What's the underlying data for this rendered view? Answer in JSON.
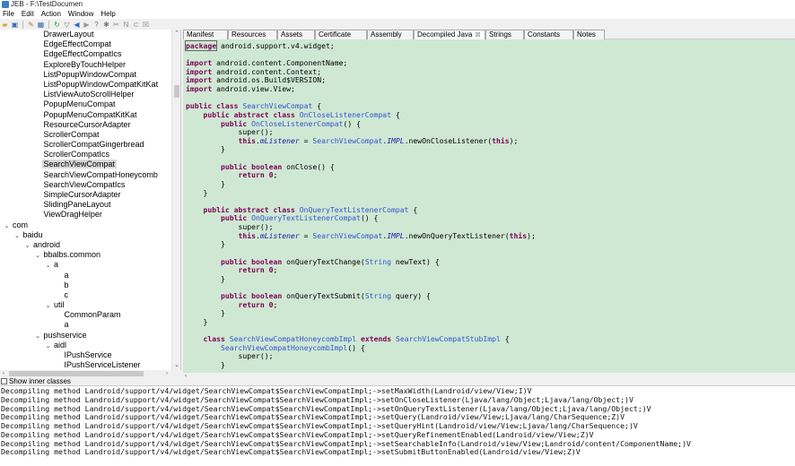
{
  "window": {
    "title": "JEB - F:\\TestDocumen"
  },
  "menu": [
    "File",
    "Edit",
    "Action",
    "Window",
    "Help"
  ],
  "toolbar_icons": [
    "open-icon",
    "save-icon",
    "wrench-icon",
    "grid-icon",
    "refresh-icon",
    "bookmark-icon",
    "back-icon",
    "forward-icon",
    "help-icon",
    "settings-icon",
    "cut-icon",
    "rename-icon",
    "link-icon",
    "comment-icon"
  ],
  "tree": {
    "rows": [
      {
        "label": "DrawerLayout",
        "indent": 3,
        "toggle": ""
      },
      {
        "label": "EdgeEffectCompat",
        "indent": 3,
        "toggle": ""
      },
      {
        "label": "EdgeEffectCompatIcs",
        "indent": 3,
        "toggle": ""
      },
      {
        "label": "ExploreByTouchHelper",
        "indent": 3,
        "toggle": ""
      },
      {
        "label": "ListPopupWindowCompat",
        "indent": 3,
        "toggle": ""
      },
      {
        "label": "ListPopupWindowCompatKitKat",
        "indent": 3,
        "toggle": ""
      },
      {
        "label": "ListViewAutoScrollHelper",
        "indent": 3,
        "toggle": ""
      },
      {
        "label": "PopupMenuCompat",
        "indent": 3,
        "toggle": ""
      },
      {
        "label": "PopupMenuCompatKitKat",
        "indent": 3,
        "toggle": ""
      },
      {
        "label": "ResourceCursorAdapter",
        "indent": 3,
        "toggle": ""
      },
      {
        "label": "ScrollerCompat",
        "indent": 3,
        "toggle": ""
      },
      {
        "label": "ScrollerCompatGingerbread",
        "indent": 3,
        "toggle": ""
      },
      {
        "label": "ScrollerCompatIcs",
        "indent": 3,
        "toggle": ""
      },
      {
        "label": "SearchViewCompat",
        "indent": 3,
        "toggle": "",
        "selected": true
      },
      {
        "label": "SearchViewCompatHoneycomb",
        "indent": 3,
        "toggle": ""
      },
      {
        "label": "SearchViewCompatIcs",
        "indent": 3,
        "toggle": ""
      },
      {
        "label": "SimpleCursorAdapter",
        "indent": 3,
        "toggle": ""
      },
      {
        "label": "SlidingPaneLayout",
        "indent": 3,
        "toggle": ""
      },
      {
        "label": "ViewDragHelper",
        "indent": 3,
        "toggle": ""
      },
      {
        "label": "com",
        "indent": 0,
        "toggle": "v"
      },
      {
        "label": "baidu",
        "indent": 1,
        "toggle": "v"
      },
      {
        "label": "android",
        "indent": 2,
        "toggle": "v"
      },
      {
        "label": "bbalbs.common",
        "indent": 3,
        "toggle": "v"
      },
      {
        "label": "a",
        "indent": 4,
        "toggle": "v"
      },
      {
        "label": "a",
        "indent": 5,
        "toggle": ""
      },
      {
        "label": "b",
        "indent": 5,
        "toggle": ""
      },
      {
        "label": "c",
        "indent": 5,
        "toggle": ""
      },
      {
        "label": "util",
        "indent": 4,
        "toggle": "v"
      },
      {
        "label": "CommonParam",
        "indent": 5,
        "toggle": ""
      },
      {
        "label": "a",
        "indent": 5,
        "toggle": ""
      },
      {
        "label": "pushservice",
        "indent": 3,
        "toggle": "v"
      },
      {
        "label": "aidl",
        "indent": 4,
        "toggle": "v"
      },
      {
        "label": "IPushService",
        "indent": 5,
        "toggle": ""
      },
      {
        "label": "IPushServiceListener",
        "indent": 5,
        "toggle": ""
      }
    ],
    "show_inner_classes": "Show inner classes"
  },
  "tabs": [
    {
      "label": "Manifest",
      "active": false
    },
    {
      "label": "Resources",
      "active": false
    },
    {
      "label": "Assets",
      "active": false
    },
    {
      "label": "Certificate",
      "active": false
    },
    {
      "label": "Assembly",
      "active": false
    },
    {
      "label": "Decompiled Java",
      "active": true
    },
    {
      "label": "Strings",
      "active": false
    },
    {
      "label": "Constants",
      "active": false
    },
    {
      "label": "Notes",
      "active": false
    }
  ],
  "colors": {
    "code_bg": "#cfe8d4",
    "keyword": "#7f0055",
    "type": "#3355cc"
  },
  "code": [
    {
      "line": 0,
      "tokens": [
        [
          "k",
          "package"
        ],
        [
          "t",
          " android.support.v4.widget;"
        ]
      ]
    },
    {
      "line": 2,
      "tokens": [
        [
          "k",
          "import"
        ],
        [
          "t",
          " android.content.ComponentName;"
        ]
      ]
    },
    {
      "line": 3,
      "tokens": [
        [
          "k",
          "import"
        ],
        [
          "t",
          " android.content.Context;"
        ]
      ]
    },
    {
      "line": 4,
      "tokens": [
        [
          "k",
          "import"
        ],
        [
          "t",
          " android.os.Build$VERSION;"
        ]
      ]
    },
    {
      "line": 5,
      "tokens": [
        [
          "k",
          "import"
        ],
        [
          "t",
          " android.view.View;"
        ]
      ]
    },
    {
      "line": 7,
      "tokens": [
        [
          "k",
          "public class"
        ],
        [
          "t",
          " "
        ],
        [
          "y",
          "SearchViewCompat"
        ],
        [
          "t",
          " {"
        ]
      ]
    },
    {
      "line": 8,
      "tokens": [
        [
          "t",
          "    "
        ],
        [
          "k",
          "public abstract class"
        ],
        [
          "t",
          " "
        ],
        [
          "y",
          "OnCloseListenerCompat"
        ],
        [
          "t",
          " {"
        ]
      ]
    },
    {
      "line": 9,
      "tokens": [
        [
          "t",
          "        "
        ],
        [
          "k",
          "public"
        ],
        [
          "t",
          " "
        ],
        [
          "y",
          "OnCloseListenerCompat"
        ],
        [
          "t",
          "() {"
        ]
      ]
    },
    {
      "line": 10,
      "tokens": [
        [
          "t",
          "            super();"
        ]
      ]
    },
    {
      "line": 11,
      "tokens": [
        [
          "t",
          "            "
        ],
        [
          "k",
          "this"
        ],
        [
          "t",
          "."
        ],
        [
          "i",
          "mListener"
        ],
        [
          "t",
          " = "
        ],
        [
          "y",
          "SearchViewCompat"
        ],
        [
          "t",
          "."
        ],
        [
          "i",
          "IMPL"
        ],
        [
          "t",
          ".newOnCloseListener("
        ],
        [
          "k",
          "this"
        ],
        [
          "t",
          ");"
        ]
      ]
    },
    {
      "line": 12,
      "tokens": [
        [
          "t",
          "        }"
        ]
      ]
    },
    {
      "line": 14,
      "tokens": [
        [
          "t",
          "        "
        ],
        [
          "k",
          "public boolean"
        ],
        [
          "t",
          " onClose() {"
        ]
      ]
    },
    {
      "line": 15,
      "tokens": [
        [
          "t",
          "            "
        ],
        [
          "k",
          "return 0"
        ],
        [
          "t",
          ";"
        ]
      ]
    },
    {
      "line": 16,
      "tokens": [
        [
          "t",
          "        }"
        ]
      ]
    },
    {
      "line": 17,
      "tokens": [
        [
          "t",
          "    }"
        ]
      ]
    },
    {
      "line": 19,
      "tokens": [
        [
          "t",
          "    "
        ],
        [
          "k",
          "public abstract class"
        ],
        [
          "t",
          " "
        ],
        [
          "y",
          "OnQueryTextListenerCompat"
        ],
        [
          "t",
          " {"
        ]
      ]
    },
    {
      "line": 20,
      "tokens": [
        [
          "t",
          "        "
        ],
        [
          "k",
          "public"
        ],
        [
          "t",
          " "
        ],
        [
          "y",
          "OnQueryTextListenerCompat"
        ],
        [
          "t",
          "() {"
        ]
      ]
    },
    {
      "line": 21,
      "tokens": [
        [
          "t",
          "            super();"
        ]
      ]
    },
    {
      "line": 22,
      "tokens": [
        [
          "t",
          "            "
        ],
        [
          "k",
          "this"
        ],
        [
          "t",
          "."
        ],
        [
          "i",
          "mListener"
        ],
        [
          "t",
          " = "
        ],
        [
          "y",
          "SearchViewCompat"
        ],
        [
          "t",
          "."
        ],
        [
          "i",
          "IMPL"
        ],
        [
          "t",
          ".newOnQueryTextListener("
        ],
        [
          "k",
          "this"
        ],
        [
          "t",
          ");"
        ]
      ]
    },
    {
      "line": 23,
      "tokens": [
        [
          "t",
          "        }"
        ]
      ]
    },
    {
      "line": 25,
      "tokens": [
        [
          "t",
          "        "
        ],
        [
          "k",
          "public boolean"
        ],
        [
          "t",
          " onQueryTextChange("
        ],
        [
          "y",
          "String"
        ],
        [
          "t",
          " newText) {"
        ]
      ]
    },
    {
      "line": 26,
      "tokens": [
        [
          "t",
          "            "
        ],
        [
          "k",
          "return 0"
        ],
        [
          "t",
          ";"
        ]
      ]
    },
    {
      "line": 27,
      "tokens": [
        [
          "t",
          "        }"
        ]
      ]
    },
    {
      "line": 29,
      "tokens": [
        [
          "t",
          "        "
        ],
        [
          "k",
          "public boolean"
        ],
        [
          "t",
          " onQueryTextSubmit("
        ],
        [
          "y",
          "String"
        ],
        [
          "t",
          " query) {"
        ]
      ]
    },
    {
      "line": 30,
      "tokens": [
        [
          "t",
          "            "
        ],
        [
          "k",
          "return 0"
        ],
        [
          "t",
          ";"
        ]
      ]
    },
    {
      "line": 31,
      "tokens": [
        [
          "t",
          "        }"
        ]
      ]
    },
    {
      "line": 32,
      "tokens": [
        [
          "t",
          "    }"
        ]
      ]
    },
    {
      "line": 34,
      "tokens": [
        [
          "t",
          "    "
        ],
        [
          "k",
          "class"
        ],
        [
          "t",
          " "
        ],
        [
          "y",
          "SearchViewCompatHoneycombImpl"
        ],
        [
          "t",
          " "
        ],
        [
          "k",
          "extends"
        ],
        [
          "t",
          " "
        ],
        [
          "y",
          "SearchViewCompatStubImpl"
        ],
        [
          "t",
          " {"
        ]
      ]
    },
    {
      "line": 35,
      "tokens": [
        [
          "t",
          "        "
        ],
        [
          "y",
          "SearchViewCompatHoneycombImpl"
        ],
        [
          "t",
          "() {"
        ]
      ]
    },
    {
      "line": 36,
      "tokens": [
        [
          "t",
          "            super();"
        ]
      ]
    },
    {
      "line": 37,
      "tokens": [
        [
          "t",
          "        }"
        ]
      ]
    }
  ],
  "console": [
    "Decompiling method Landroid/support/v4/widget/SearchViewCompat$SearchViewCompatImpl;->setMaxWidth(Landroid/view/View;I)V",
    "Decompiling method Landroid/support/v4/widget/SearchViewCompat$SearchViewCompatImpl;->setOnCloseListener(Ljava/lang/Object;Ljava/lang/Object;)V",
    "Decompiling method Landroid/support/v4/widget/SearchViewCompat$SearchViewCompatImpl;->setOnQueryTextListener(Ljava/lang/Object;Ljava/lang/Object;)V",
    "Decompiling method Landroid/support/v4/widget/SearchViewCompat$SearchViewCompatImpl;->setQuery(Landroid/view/View;Ljava/lang/CharSequence;Z)V",
    "Decompiling method Landroid/support/v4/widget/SearchViewCompat$SearchViewCompatImpl;->setQueryHint(Landroid/view/View;Ljava/lang/CharSequence;)V",
    "Decompiling method Landroid/support/v4/widget/SearchViewCompat$SearchViewCompatImpl;->setQueryRefinementEnabled(Landroid/view/View;Z)V",
    "Decompiling method Landroid/support/v4/widget/SearchViewCompat$SearchViewCompatImpl;->setSearchableInfo(Landroid/view/View;Landroid/content/ComponentName;)V",
    "Decompiling method Landroid/support/v4/widget/SearchViewCompat$SearchViewCompatImpl;->setSubmitButtonEnabled(Landroid/view/View;Z)V"
  ]
}
